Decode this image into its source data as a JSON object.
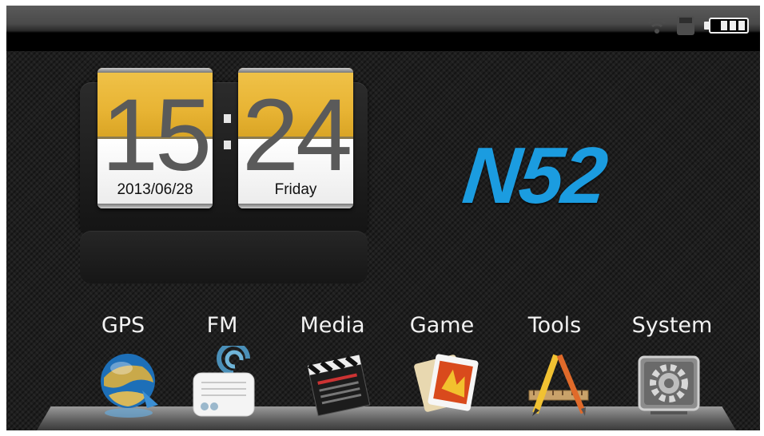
{
  "status_bar": {
    "wifi_icon": "wifi-icon",
    "sd_icon": "sd-card-icon",
    "battery_icon": "battery-icon",
    "battery_level": 1.0
  },
  "clock": {
    "hours": "15",
    "minutes": "24",
    "date": "2013/06/28",
    "weekday": "Friday"
  },
  "brand": {
    "logo_text": "N52",
    "color": "#1b9ce0"
  },
  "menu": [
    {
      "label": "GPS",
      "icon": "globe-icon"
    },
    {
      "label": "FM",
      "icon": "radio-icon"
    },
    {
      "label": "Media",
      "icon": "clapperboard-icon"
    },
    {
      "label": "Game",
      "icon": "game-cards-icon"
    },
    {
      "label": "Tools",
      "icon": "pencil-ruler-icon"
    },
    {
      "label": "System",
      "icon": "gear-icon"
    }
  ],
  "colors": {
    "flip_gold": "#e8b434",
    "label_text": "#f2f2f2"
  }
}
